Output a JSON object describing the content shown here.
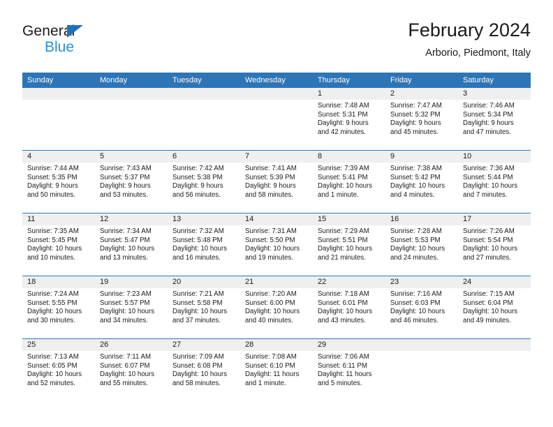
{
  "brand": {
    "line1": "General",
    "line2": "Blue",
    "triangle_color": "#1d72b8",
    "blue_color": "#2a8fd8"
  },
  "header": {
    "title": "February 2024",
    "subtitle": "Arborio, Piedmont, Italy"
  },
  "colors": {
    "header_blue": "#2e75b6",
    "daynum_band": "#efefef",
    "text": "#1a1a1a"
  },
  "weekdays": [
    "Sunday",
    "Monday",
    "Tuesday",
    "Wednesday",
    "Thursday",
    "Friday",
    "Saturday"
  ],
  "weeks": [
    {
      "days": [
        {
          "empty": true
        },
        {
          "empty": true
        },
        {
          "empty": true
        },
        {
          "empty": true
        },
        {
          "num": "1",
          "sunrise": "Sunrise: 7:48 AM",
          "sunset": "Sunset: 5:31 PM",
          "daylight": "Daylight: 9 hours and 42 minutes."
        },
        {
          "num": "2",
          "sunrise": "Sunrise: 7:47 AM",
          "sunset": "Sunset: 5:32 PM",
          "daylight": "Daylight: 9 hours and 45 minutes."
        },
        {
          "num": "3",
          "sunrise": "Sunrise: 7:46 AM",
          "sunset": "Sunset: 5:34 PM",
          "daylight": "Daylight: 9 hours and 47 minutes."
        }
      ]
    },
    {
      "days": [
        {
          "num": "4",
          "sunrise": "Sunrise: 7:44 AM",
          "sunset": "Sunset: 5:35 PM",
          "daylight": "Daylight: 9 hours and 50 minutes."
        },
        {
          "num": "5",
          "sunrise": "Sunrise: 7:43 AM",
          "sunset": "Sunset: 5:37 PM",
          "daylight": "Daylight: 9 hours and 53 minutes."
        },
        {
          "num": "6",
          "sunrise": "Sunrise: 7:42 AM",
          "sunset": "Sunset: 5:38 PM",
          "daylight": "Daylight: 9 hours and 56 minutes."
        },
        {
          "num": "7",
          "sunrise": "Sunrise: 7:41 AM",
          "sunset": "Sunset: 5:39 PM",
          "daylight": "Daylight: 9 hours and 58 minutes."
        },
        {
          "num": "8",
          "sunrise": "Sunrise: 7:39 AM",
          "sunset": "Sunset: 5:41 PM",
          "daylight": "Daylight: 10 hours and 1 minute."
        },
        {
          "num": "9",
          "sunrise": "Sunrise: 7:38 AM",
          "sunset": "Sunset: 5:42 PM",
          "daylight": "Daylight: 10 hours and 4 minutes."
        },
        {
          "num": "10",
          "sunrise": "Sunrise: 7:36 AM",
          "sunset": "Sunset: 5:44 PM",
          "daylight": "Daylight: 10 hours and 7 minutes."
        }
      ]
    },
    {
      "days": [
        {
          "num": "11",
          "sunrise": "Sunrise: 7:35 AM",
          "sunset": "Sunset: 5:45 PM",
          "daylight": "Daylight: 10 hours and 10 minutes."
        },
        {
          "num": "12",
          "sunrise": "Sunrise: 7:34 AM",
          "sunset": "Sunset: 5:47 PM",
          "daylight": "Daylight: 10 hours and 13 minutes."
        },
        {
          "num": "13",
          "sunrise": "Sunrise: 7:32 AM",
          "sunset": "Sunset: 5:48 PM",
          "daylight": "Daylight: 10 hours and 16 minutes."
        },
        {
          "num": "14",
          "sunrise": "Sunrise: 7:31 AM",
          "sunset": "Sunset: 5:50 PM",
          "daylight": "Daylight: 10 hours and 19 minutes."
        },
        {
          "num": "15",
          "sunrise": "Sunrise: 7:29 AM",
          "sunset": "Sunset: 5:51 PM",
          "daylight": "Daylight: 10 hours and 21 minutes."
        },
        {
          "num": "16",
          "sunrise": "Sunrise: 7:28 AM",
          "sunset": "Sunset: 5:53 PM",
          "daylight": "Daylight: 10 hours and 24 minutes."
        },
        {
          "num": "17",
          "sunrise": "Sunrise: 7:26 AM",
          "sunset": "Sunset: 5:54 PM",
          "daylight": "Daylight: 10 hours and 27 minutes."
        }
      ]
    },
    {
      "days": [
        {
          "num": "18",
          "sunrise": "Sunrise: 7:24 AM",
          "sunset": "Sunset: 5:55 PM",
          "daylight": "Daylight: 10 hours and 30 minutes."
        },
        {
          "num": "19",
          "sunrise": "Sunrise: 7:23 AM",
          "sunset": "Sunset: 5:57 PM",
          "daylight": "Daylight: 10 hours and 34 minutes."
        },
        {
          "num": "20",
          "sunrise": "Sunrise: 7:21 AM",
          "sunset": "Sunset: 5:58 PM",
          "daylight": "Daylight: 10 hours and 37 minutes."
        },
        {
          "num": "21",
          "sunrise": "Sunrise: 7:20 AM",
          "sunset": "Sunset: 6:00 PM",
          "daylight": "Daylight: 10 hours and 40 minutes."
        },
        {
          "num": "22",
          "sunrise": "Sunrise: 7:18 AM",
          "sunset": "Sunset: 6:01 PM",
          "daylight": "Daylight: 10 hours and 43 minutes."
        },
        {
          "num": "23",
          "sunrise": "Sunrise: 7:16 AM",
          "sunset": "Sunset: 6:03 PM",
          "daylight": "Daylight: 10 hours and 46 minutes."
        },
        {
          "num": "24",
          "sunrise": "Sunrise: 7:15 AM",
          "sunset": "Sunset: 6:04 PM",
          "daylight": "Daylight: 10 hours and 49 minutes."
        }
      ]
    },
    {
      "days": [
        {
          "num": "25",
          "sunrise": "Sunrise: 7:13 AM",
          "sunset": "Sunset: 6:05 PM",
          "daylight": "Daylight: 10 hours and 52 minutes."
        },
        {
          "num": "26",
          "sunrise": "Sunrise: 7:11 AM",
          "sunset": "Sunset: 6:07 PM",
          "daylight": "Daylight: 10 hours and 55 minutes."
        },
        {
          "num": "27",
          "sunrise": "Sunrise: 7:09 AM",
          "sunset": "Sunset: 6:08 PM",
          "daylight": "Daylight: 10 hours and 58 minutes."
        },
        {
          "num": "28",
          "sunrise": "Sunrise: 7:08 AM",
          "sunset": "Sunset: 6:10 PM",
          "daylight": "Daylight: 11 hours and 1 minute."
        },
        {
          "num": "29",
          "sunrise": "Sunrise: 7:06 AM",
          "sunset": "Sunset: 6:11 PM",
          "daylight": "Daylight: 11 hours and 5 minutes."
        },
        {
          "empty": true
        },
        {
          "empty": true
        }
      ]
    }
  ]
}
